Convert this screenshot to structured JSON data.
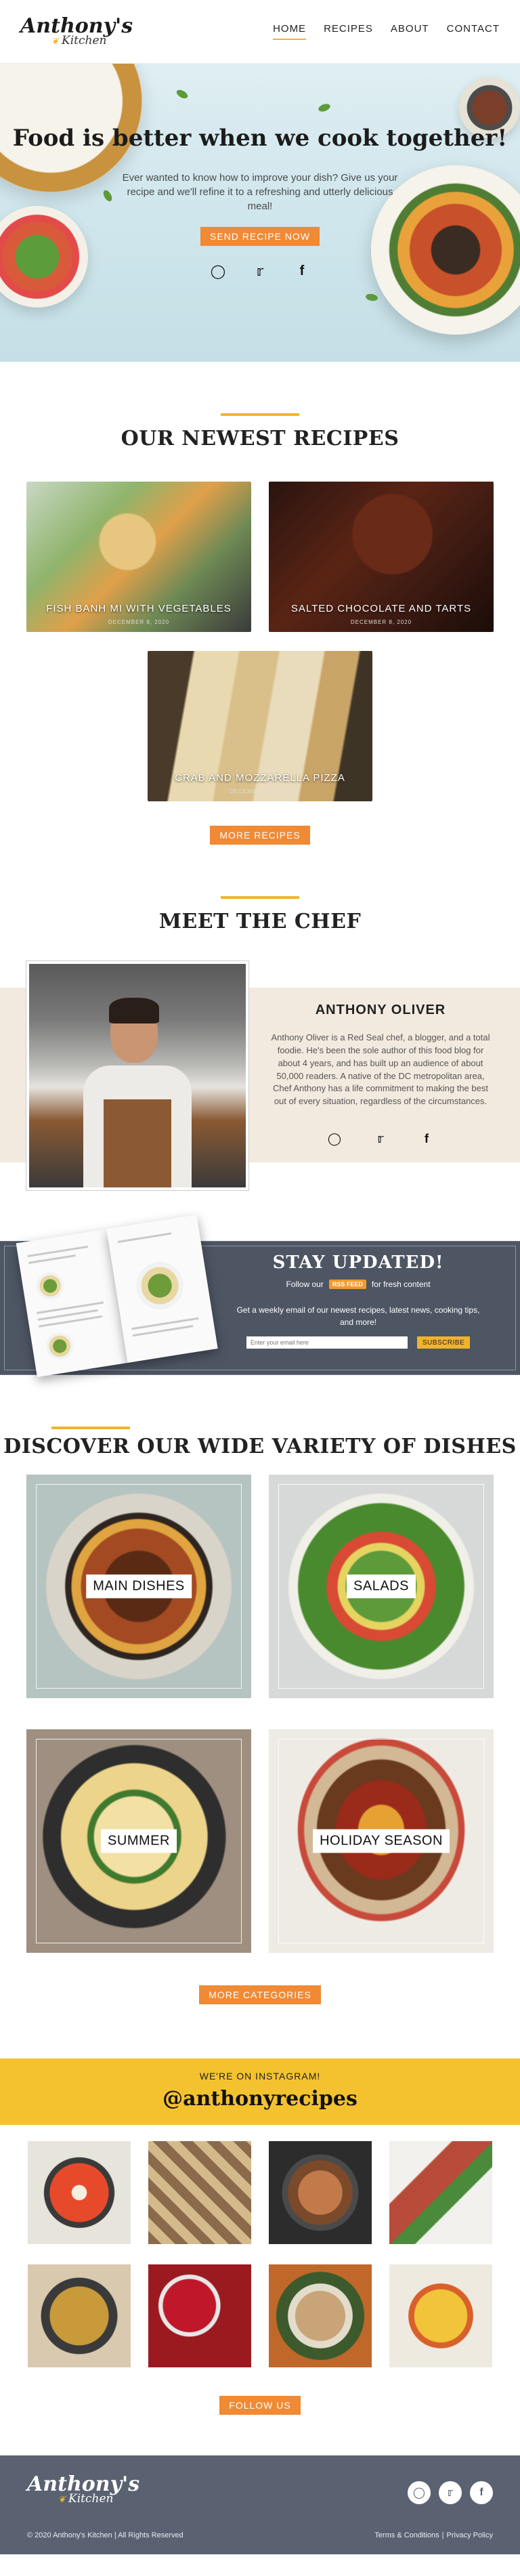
{
  "brand": {
    "name": "Anthony's",
    "sub": "Kitchen"
  },
  "nav": [
    {
      "label": "HOME"
    },
    {
      "label": "RECIPES"
    },
    {
      "label": "ABOUT"
    },
    {
      "label": "CONTACT"
    }
  ],
  "hero": {
    "title": "Food is better when we cook together!",
    "text": "Ever wanted to know how to improve your dish? Give us your recipe and we'll refine it to a refreshing and utterly delicious meal!",
    "button": "SEND RECIPE NOW"
  },
  "icons": {
    "instagram": "instagram-icon",
    "twitter": "twitter-icon",
    "facebook": "facebook-icon",
    "rss": "rss-icon"
  },
  "recipes": {
    "heading": "OUR NEWEST RECIPES",
    "items": [
      {
        "title": "FISH BANH MI WITH VEGETABLES",
        "date": "DECEMBER 8, 2020"
      },
      {
        "title": "SALTED CHOCOLATE AND TARTS",
        "date": "DECEMBER 8, 2020"
      },
      {
        "title": "CRAB AND MOZZARELLA PIZZA",
        "date": "DECEMBER 8, 2020"
      }
    ],
    "more_button": "MORE RECIPES"
  },
  "chef": {
    "heading": "MEET THE CHEF",
    "name": "ANTHONY OLIVER",
    "bio": "Anthony Oliver is a Red Seal chef, a blogger, and a total foodie. He's been the sole author of this food blog for about 4 years, and has built up an audience of about 50,000 readers. A native of the DC metropolitan area, Chef Anthony has a life commitment to making the best out of every situation, regardless of the circumstances."
  },
  "newsletter": {
    "title": "STAY UPDATED!",
    "follow_prefix": "Follow our",
    "rss_label": "RSS FEED",
    "follow_suffix": "for fresh content",
    "description": "Get a weekly email of our newest recipes, latest news, cooking tips, and more!",
    "input_placeholder": "Enter your email here",
    "subscribe": "SUBSCRIBE"
  },
  "dishes": {
    "heading": "DISCOVER OUR WIDE VARIETY OF DISHES",
    "items": [
      {
        "label": "MAIN DISHES"
      },
      {
        "label": "SALADS"
      },
      {
        "label": "SUMMER"
      },
      {
        "label": "HOLIDAY SEASON"
      }
    ],
    "more_button": "MORE CATEGORIES"
  },
  "instagram": {
    "kicker": "WE'RE ON INSTAGRAM!",
    "handle": "@anthonyrecipes",
    "follow_button": "FOLLOW US"
  },
  "footer": {
    "copyright": "© 2020 Anthony's Kitchen | All Rights Reserved",
    "terms": "Terms & Conditions",
    "separator": "|",
    "privacy": "Privacy Policy"
  },
  "colors": {
    "accent": "#f08a34",
    "yellow": "#f0b428",
    "slate": "#4e5664",
    "cream": "#f3eadf"
  }
}
